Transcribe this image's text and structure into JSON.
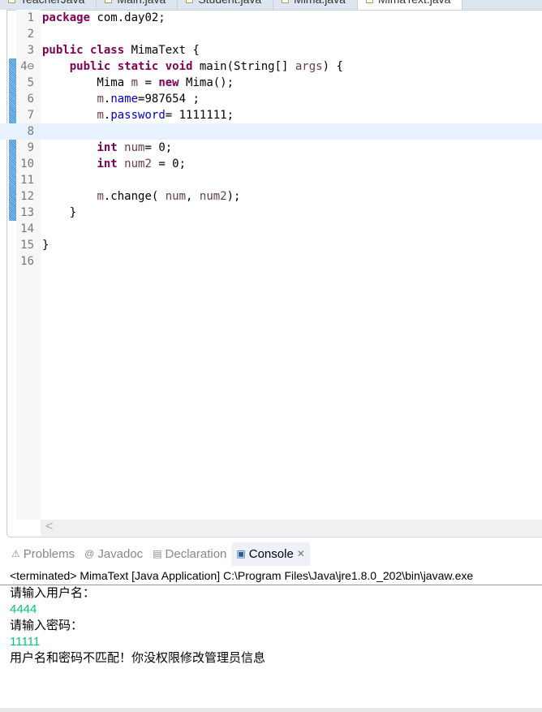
{
  "editor_tabs": [
    "TeacherJava",
    "Main.java",
    "Student.java",
    "Mima.java",
    "MimaText.java"
  ],
  "code_lines": [
    {
      "n": "1",
      "html": "<span class='kw'>package</span> com.day02;"
    },
    {
      "n": "2",
      "html": ""
    },
    {
      "n": "3",
      "html": "<span class='kw'>public class</span> MimaText {"
    },
    {
      "n": "4⊖",
      "html": "    <span class='kw'>public static void</span> main(String[] <span class='var'>args</span>) {"
    },
    {
      "n": "5",
      "html": "        Mima <span class='var'>m</span> = <span class='kw'>new</span> Mima();"
    },
    {
      "n": "6",
      "html": "        <span class='var'>m</span>.<span class='fld'>name</span>=987654 ;"
    },
    {
      "n": "7",
      "html": "        <span class='var'>m</span>.<span class='fld'>password</span>= 1111111;"
    },
    {
      "n": "8",
      "html": "",
      "current": true
    },
    {
      "n": "9",
      "html": "        <span class='kw'>int</span> <span class='var'>num</span>= 0;"
    },
    {
      "n": "10",
      "html": "        <span class='kw'>int</span> <span class='var'>num2</span> = 0;"
    },
    {
      "n": "11",
      "html": ""
    },
    {
      "n": "12",
      "html": "        <span class='var'>m</span>.change( <span class='var'>num</span>, <span class='var'>num2</span>);"
    },
    {
      "n": "13",
      "html": "    }"
    },
    {
      "n": "14",
      "html": ""
    },
    {
      "n": "15",
      "html": "}"
    },
    {
      "n": "16",
      "html": ""
    }
  ],
  "bottom_tabs": {
    "problems": "Problems",
    "javadoc": "Javadoc",
    "declaration": "Declaration",
    "console": "Console"
  },
  "console": {
    "header": "<terminated> MimaText [Java Application] C:\\Program Files\\Java\\jre1.8.0_202\\bin\\javaw.exe",
    "lines": [
      {
        "text": "请输入用户名：",
        "input": false
      },
      {
        "text": "4444",
        "input": true
      },
      {
        "text": "请输入密码：",
        "input": false
      },
      {
        "text": "11111",
        "input": true
      },
      {
        "text": "用户名和密码不匹配！你没权限修改管理员信息",
        "input": false
      }
    ]
  }
}
